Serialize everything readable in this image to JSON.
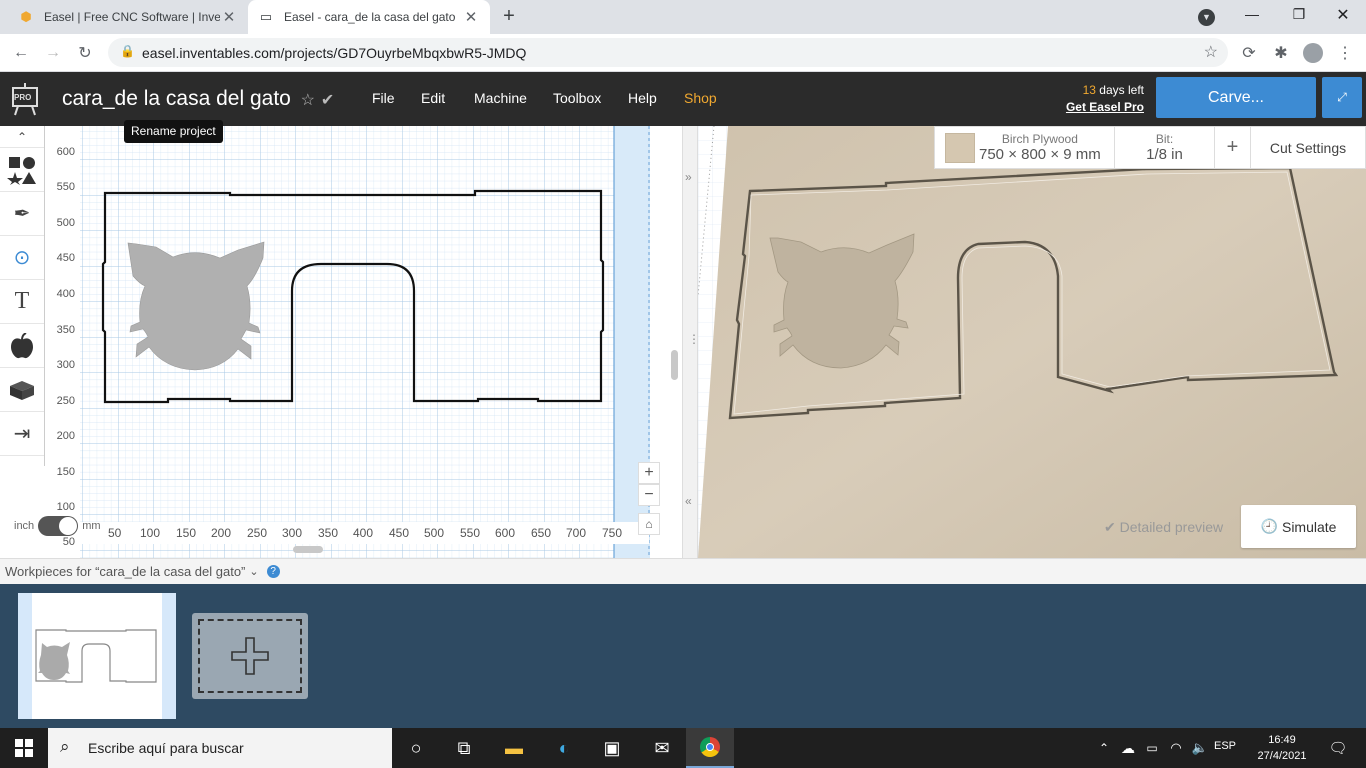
{
  "browser": {
    "tabs": [
      {
        "label": "Easel | Free CNC Software | Inven",
        "active": false
      },
      {
        "label": "Easel - cara_de la casa del gato",
        "active": true
      }
    ],
    "new_tab": "+",
    "url": "easel.inventables.com/projects/GD7OuyrbeMbqxbwR5-JMDQ"
  },
  "app": {
    "logo_text": "PRO",
    "project_title": "cara_de la casa del gato",
    "tooltip": "Rename project",
    "menu": [
      "File",
      "Edit",
      "Machine",
      "Toolbox",
      "Help",
      "Shop"
    ],
    "trial_days": "13",
    "trial_suffix": "days left",
    "trial_link": "Get Easel Pro",
    "carve_label": "Carve...",
    "accent": "#3d8bd3",
    "shop_color": "#f0a830"
  },
  "design": {
    "y_ticks": [
      "600",
      "550",
      "500",
      "450",
      "400",
      "350",
      "300",
      "250",
      "200",
      "150",
      "100",
      "50"
    ],
    "x_ticks": [
      "50",
      "100",
      "150",
      "200",
      "250",
      "300",
      "350",
      "400",
      "450",
      "500",
      "550",
      "600",
      "650",
      "700",
      "750"
    ],
    "unit_left": "inch",
    "unit_right": "mm"
  },
  "material": {
    "name": "Birch Plywood",
    "dims": "750 × 800 × 9 mm",
    "bit_label": "Bit:",
    "bit_value": "1/8 in",
    "plus": "+",
    "cut_settings": "Cut Settings"
  },
  "preview": {
    "detailed_label": "Detailed preview",
    "simulate_label": "Simulate"
  },
  "workpieces": {
    "label": "Workpieces for “cara_de la casa del gato”"
  },
  "taskbar": {
    "search_placeholder": "Escribe aquí para buscar",
    "lang": "ESP",
    "time": "16:49",
    "date": "27/4/2021"
  }
}
